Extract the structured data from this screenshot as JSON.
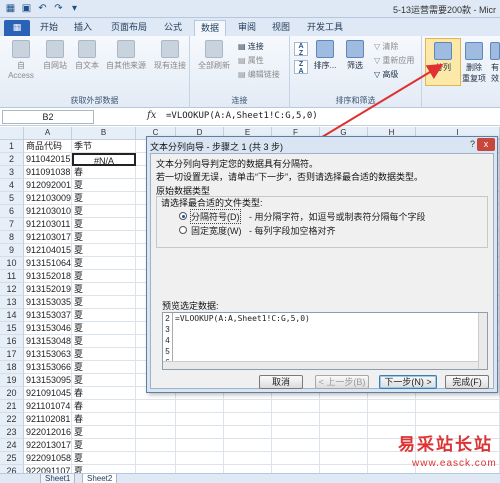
{
  "window": {
    "title": "5-13运营需要200款 - Micr"
  },
  "quick_access": [
    "save-icon",
    "undo-icon",
    "redo-icon",
    "customize-icon"
  ],
  "tabs": [
    "开始",
    "插入",
    "页面布局",
    "公式",
    "数据",
    "审阅",
    "视图",
    "开发工具"
  ],
  "active_tab": "数据",
  "ribbon": {
    "get_external": {
      "label": "获取外部数据",
      "buttons": [
        "自 Access",
        "自网站",
        "自文本",
        "自其他来源",
        "现有连接"
      ]
    },
    "connections": {
      "label": "连接",
      "refresh_all": "全部刷新",
      "items": [
        "连接",
        "属性",
        "编辑链接"
      ]
    },
    "sort_filter": {
      "label": "排序和筛选",
      "sort": "排序...",
      "filter": "筛选",
      "items": [
        "清除",
        "重新应用",
        "高级"
      ]
    },
    "data_tools": {
      "split": "分列",
      "remove_dup": "删除",
      "remove_dup2": "重复项",
      "more": "有效"
    }
  },
  "formula_bar": {
    "name_box": "B2",
    "fx": "fx",
    "formula": "=VLOOKUP(A:A,Sheet1!C:G,5,0)"
  },
  "grid": {
    "columns": [
      "A",
      "B",
      "C",
      "D",
      "E",
      "F",
      "G",
      "H",
      "I"
    ],
    "row_numbers": [
      "1",
      "2",
      "3",
      "4",
      "5",
      "6",
      "7",
      "8",
      "9",
      "10",
      "11",
      "12",
      "13",
      "14",
      "15",
      "16",
      "17",
      "18",
      "19",
      "20",
      "21",
      "22",
      "23",
      "24",
      "25",
      "26",
      "27",
      "28",
      "29",
      "30",
      "31",
      "32",
      "33",
      "34",
      "35"
    ],
    "col_a": [
      "商品代码",
      "911042015",
      "911091038",
      "912092001",
      "912103009",
      "912103010",
      "912103011",
      "912103017",
      "912104015",
      "913151064",
      "913152018",
      "913152019",
      "913153035",
      "913153037",
      "913153046",
      "913153048",
      "913153063",
      "913153066",
      "913153095",
      "921091045",
      "921101074",
      "921102081",
      "922012016",
      "922013017",
      "922091058",
      "922091107",
      "922092051"
    ],
    "col_b": [
      "季节",
      "#N/A",
      "春",
      "夏",
      "夏",
      "夏",
      "夏",
      "夏",
      "夏",
      "夏",
      "夏",
      "夏",
      "夏",
      "夏",
      "夏",
      "夏",
      "夏",
      "夏",
      "夏",
      "春",
      "春",
      "春",
      "夏",
      "夏",
      "夏",
      "夏",
      "夏"
    ]
  },
  "sheet_tabs": [
    "Sheet1",
    "Sheet2"
  ],
  "dialog": {
    "title": "文本分列向导 - 步骤之 1 (共 3 步)",
    "help": "?",
    "close": "x",
    "line1": "文本分列向导判定您的数据具有分隔符。",
    "line2": "若一切设置无误，请单击“下一步”，否则请选择最合适的数据类型。",
    "group_label": "原始数据类型",
    "choose_label": "请选择最合适的文件类型:",
    "option1": "分隔符号(D)",
    "option1_desc": "- 用分隔字符，如逗号或制表符分隔每个字段",
    "option2": "固定宽度(W)",
    "option2_desc": "- 每列字段加空格对齐",
    "preview_label": "预览选定数据:",
    "preview_rows": [
      "2",
      "3",
      "4",
      "5",
      "6"
    ],
    "preview_text": "=VLOOKUP(A:A,Sheet1!C:G,5,0)",
    "buttons": {
      "cancel": "取消",
      "back": "< 上一步(B)",
      "next": "下一步(N) >",
      "finish": "完成(F)"
    }
  },
  "watermark": {
    "line1": "易采站长站",
    "line2": "www.easck.com",
    "color": "#dd3333"
  },
  "colors": {
    "ribbon_bg": "#e3ebf5",
    "accent": "#2a62b8",
    "arrow": "#e03030"
  }
}
